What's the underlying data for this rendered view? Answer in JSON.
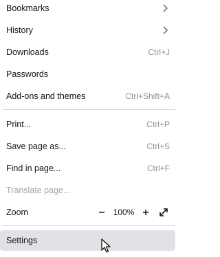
{
  "menu": {
    "bookmarks": {
      "label": "Bookmarks"
    },
    "history": {
      "label": "History"
    },
    "downloads": {
      "label": "Downloads",
      "shortcut": "Ctrl+J"
    },
    "passwords": {
      "label": "Passwords"
    },
    "addons": {
      "label": "Add-ons and themes",
      "shortcut": "Ctrl+Shift+A"
    },
    "print": {
      "label": "Print...",
      "shortcut": "Ctrl+P"
    },
    "save_page": {
      "label": "Save page as...",
      "shortcut": "Ctrl+S"
    },
    "find": {
      "label": "Find in page...",
      "shortcut": "Ctrl+F"
    },
    "translate": {
      "label": "Translate page..."
    },
    "zoom": {
      "label": "Zoom",
      "value": "100%"
    },
    "settings": {
      "label": "Settings"
    }
  },
  "icons": {
    "submenu": "chevron-right-icon",
    "zoom_out": "minus-icon",
    "zoom_in": "plus-icon",
    "fullscreen": "fullscreen-icon",
    "cursor": "mouse-pointer-icon"
  },
  "colors": {
    "hover_bg": "#e1e1e6",
    "shortcut_text": "#8f8f9d",
    "disabled_text": "#a5a5ad"
  }
}
